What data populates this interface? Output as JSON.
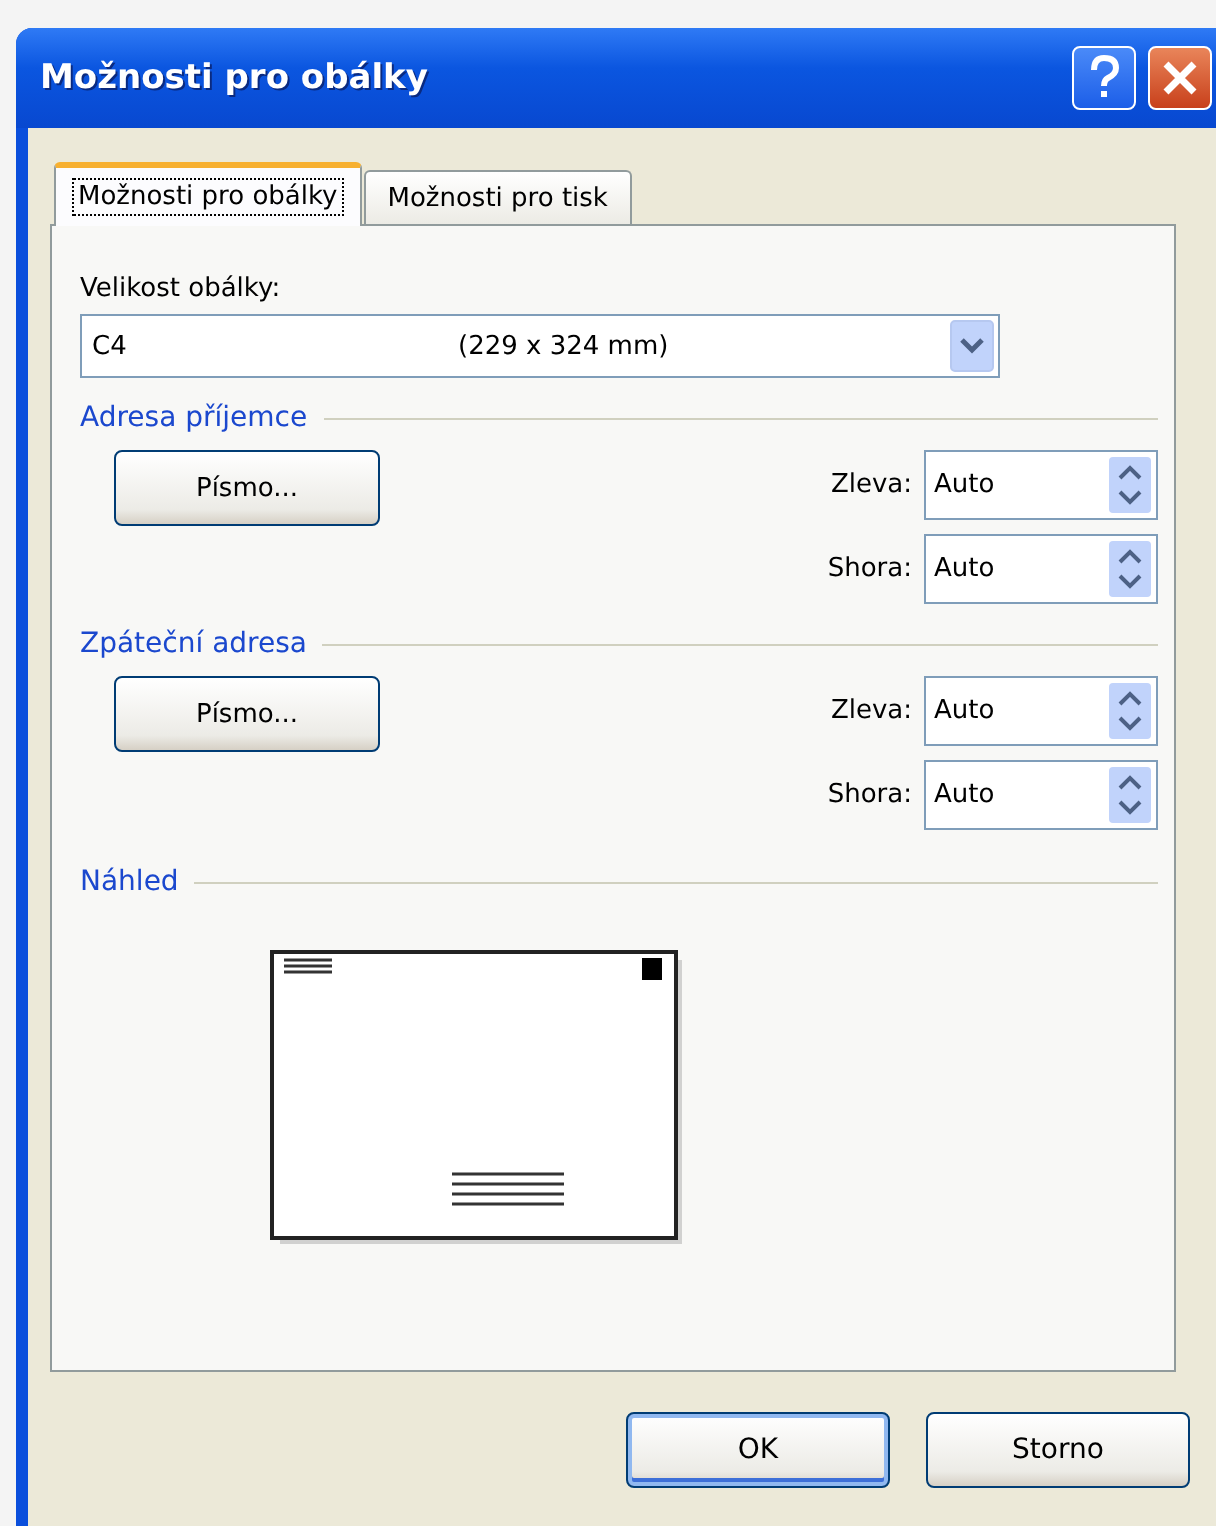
{
  "window": {
    "title": "Možnosti pro obálky"
  },
  "tabs": [
    {
      "label": "Možnosti pro obálky",
      "selected": true
    },
    {
      "label": "Možnosti pro tisk",
      "selected": false
    }
  ],
  "envelope_size": {
    "label": "Velikost obálky:",
    "value_name": "C4",
    "value_size": "(229 x 324 mm)"
  },
  "sections": [
    {
      "title": "Adresa příjemce",
      "font_button": "Písmo...",
      "fields": [
        {
          "label": "Zleva:",
          "value": "Auto"
        },
        {
          "label": "Shora:",
          "value": "Auto"
        }
      ]
    },
    {
      "title": "Zpáteční adresa",
      "font_button": "Písmo...",
      "fields": [
        {
          "label": "Zleva:",
          "value": "Auto"
        },
        {
          "label": "Shora:",
          "value": "Auto"
        }
      ]
    }
  ],
  "preview": {
    "title": "Náhled"
  },
  "buttons": [
    {
      "label": "OK",
      "default": true
    },
    {
      "label": "Storno",
      "default": false
    }
  ]
}
